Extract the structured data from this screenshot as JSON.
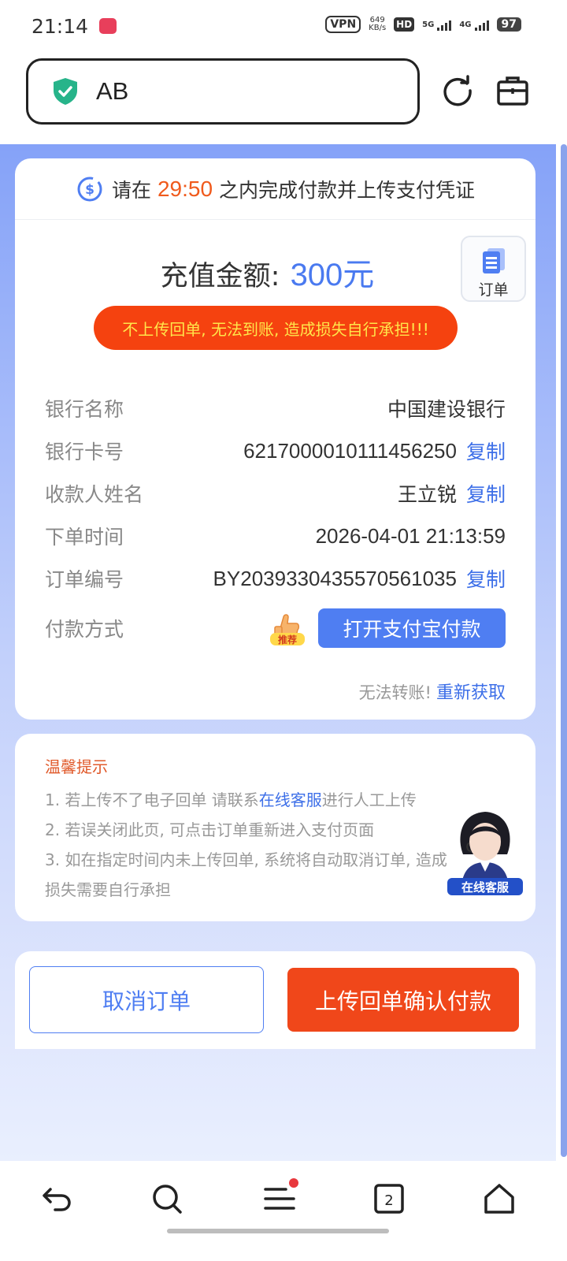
{
  "status_bar": {
    "time": "21:14",
    "vpn": "VPN",
    "speed_value": "649",
    "speed_unit": "KB/s",
    "hd": "HD",
    "net_5g": "5G",
    "net_4g": "4G",
    "battery": "97"
  },
  "browser": {
    "url_text": "AB"
  },
  "timer": {
    "prefix": "请在",
    "countdown": "29:50",
    "suffix": "之内完成付款并上传支付凭证"
  },
  "amount": {
    "label": "充值金额:",
    "value": "300元"
  },
  "order_button": {
    "label": "订单"
  },
  "warning": "不上传回单, 无法到账, 造成损失自行承担!!!",
  "info": {
    "bank_name_label": "银行名称",
    "bank_name": "中国建设银行",
    "card_no_label": "银行卡号",
    "card_no": "6217000010111456250",
    "payee_label": "收款人姓名",
    "payee": "王立锐",
    "order_time_label": "下单时间",
    "order_time": "2026-04-01 21:13:59",
    "order_no_label": "订单编号",
    "order_no": "BY2039330435570561035",
    "pay_method_label": "付款方式",
    "recommend_badge": "推荐",
    "alipay_button": "打开支付宝付款",
    "copy": "复制"
  },
  "refetch": {
    "hint": "无法转账!",
    "action": "重新获取"
  },
  "tips": {
    "title": "温馨提示",
    "tip1_pre": "1. 若上传不了电子回单 请联系",
    "tip1_link": "在线客服",
    "tip1_post": "进行人工上传",
    "tip2": "2. 若误关闭此页, 可点击订单重新进入支付页面",
    "tip3": "3. 如在指定时间内未上传回单, 系统将自动取消订单, 造成",
    "tip4": "损失需要自行承担",
    "agent_label": "在线客服"
  },
  "actions": {
    "cancel": "取消订单",
    "confirm": "上传回单确认付款"
  },
  "bottom_nav": {
    "tabs_count": "2"
  },
  "colors": {
    "accent_blue": "#4f7ef2",
    "warning_red": "#f5420f",
    "countdown_orange": "#f05a1c",
    "confirm_red": "#f0471a"
  }
}
